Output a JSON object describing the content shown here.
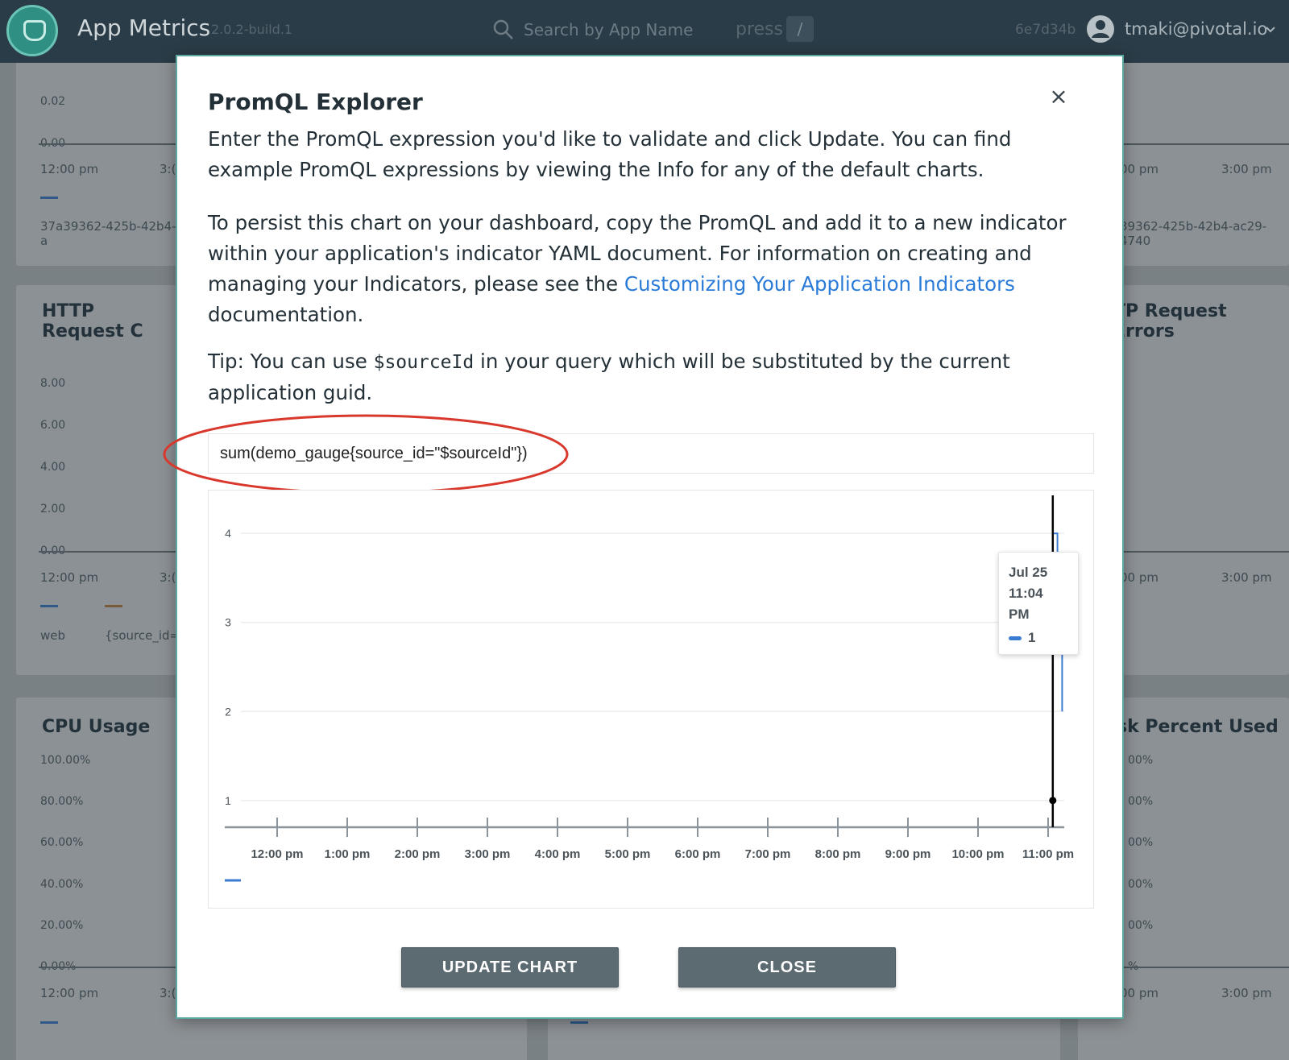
{
  "header": {
    "app_title": "App Metrics",
    "app_version": "2.0.2-build.1",
    "search_placeholder": "Search by App Name",
    "shortcut_press_label": "press",
    "shortcut_key": "/",
    "commit_hash": "6e7d34b",
    "user_email": "tmaki@pivotal.io"
  },
  "background": {
    "top_left": {
      "yticks": [
        "0.02",
        "0.00"
      ],
      "xticks": [
        "12:00 pm",
        "3:("
      ],
      "legend": "37a39362-425b-42b4-a"
    },
    "top_right": {
      "xticks": [
        "00 pm",
        "3:00 pm"
      ],
      "legend": "39362-425b-42b4-ac29-4740"
    },
    "http_requests": {
      "title": "HTTP Request C",
      "yticks": [
        "8.00",
        "6.00",
        "4.00",
        "2.00",
        "0.00"
      ],
      "xticks": [
        "12:00 pm",
        "3:("
      ],
      "legend": [
        "web",
        "{source_id="
      ]
    },
    "http_errors": {
      "title": "TP Request Errors",
      "xticks": [
        "00 pm",
        "3:00 pm"
      ]
    },
    "cpu": {
      "title": "CPU Usage",
      "yticks": [
        "100.00%",
        "80.00%",
        "60.00%",
        "40.00%",
        "20.00%",
        "0.00%"
      ],
      "xticks": [
        "12:00 pm",
        "3:("
      ]
    },
    "disk": {
      "title": "sk Percent Used",
      "yticks": [
        "00%",
        "00%",
        "00%",
        "00%",
        "00%",
        "%"
      ],
      "xticks": [
        "00 pm",
        "3:00 pm"
      ]
    }
  },
  "modal": {
    "title": "PromQL Explorer",
    "close_icon": "close-icon",
    "para1": "Enter the PromQL expression you'd like to validate and click Update. You can find example PromQL expressions by viewing the Info for any of the default charts.",
    "para2_before": "To persist this chart on your dashboard, copy the PromQL and add it to a new indicator within your application's indicator YAML document. For information on creating and managing your Indicators, please see the ",
    "para2_link": "Customizing Your Application Indicators",
    "para2_after": " documentation.",
    "tip_before": "Tip: You can use ",
    "tip_code": "$sourceId",
    "tip_after": " in your query which will be substituted by the current application guid.",
    "query_value": "sum(demo_gauge{source_id=\"$sourceId\"})",
    "tooltip": {
      "date": "Jul 25",
      "time": "11:04",
      "ampm": "PM",
      "series_value": "1"
    },
    "update_label": "UPDATE CHART",
    "close_label": "CLOSE"
  },
  "colors": {
    "series": "#3b7bd4",
    "annotation": "#d9382c",
    "link": "#2a7bd8",
    "button": "#5c6a72"
  },
  "chart_data": {
    "type": "line",
    "xlabel": "",
    "ylabel": "",
    "yticks": [
      "1",
      "2",
      "3",
      "4"
    ],
    "xticks": [
      "12:00 pm",
      "1:00 pm",
      "2:00 pm",
      "3:00 pm",
      "4:00 pm",
      "5:00 pm",
      "6:00 pm",
      "7:00 pm",
      "8:00 pm",
      "9:00 pm",
      "10:00 pm",
      "11:00 pm"
    ],
    "ylim": [
      0.7,
      4.3
    ],
    "grid": true,
    "legend_placement": "bottom-left",
    "cursor_at": "11:04 pm",
    "series": [
      {
        "name": "1",
        "x": [
          "11:04 pm",
          "11:04 pm",
          "11:08 pm",
          "11:08 pm",
          "11:12 pm",
          "11:12 pm"
        ],
        "values": [
          4,
          4,
          4,
          3,
          3,
          2
        ]
      }
    ]
  }
}
